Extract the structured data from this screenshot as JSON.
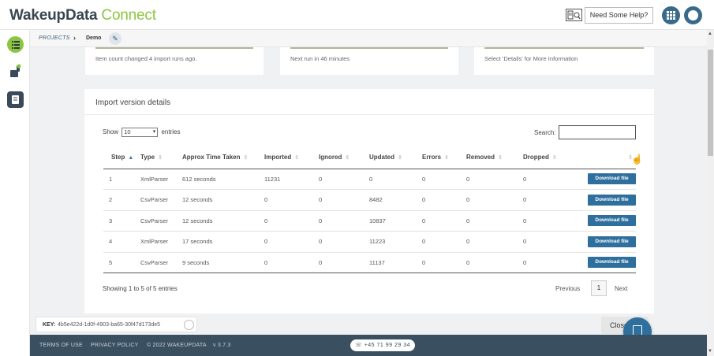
{
  "header": {
    "logo_primary": "WakeupData",
    "logo_secondary": "Connect",
    "help_label": "Need Some Help?"
  },
  "breadcrumb": {
    "projects": "PROJECTS",
    "separator": "›",
    "current": "Demo"
  },
  "summary_cards": [
    {
      "text": "Item count changed 4 import runs ago."
    },
    {
      "text": "Next run in 46 minutes"
    },
    {
      "text": "Select 'Details' for More Information"
    }
  ],
  "panel": {
    "title": "Import version details",
    "show_label": "Show",
    "page_size": "10",
    "entries_label": "entries",
    "search_label": "Search:",
    "search_value": "",
    "columns": [
      "Step",
      "Type",
      "Approx Time Taken",
      "Imported",
      "Ignored",
      "Updated",
      "Errors",
      "Removed",
      "Dropped",
      ""
    ],
    "rows": [
      {
        "step": "1",
        "type": "XmlParser",
        "time": "612 seconds",
        "imported": "11231",
        "ignored": "0",
        "updated": "0",
        "errors": "0",
        "removed": "0",
        "dropped": "0",
        "action": "Download file"
      },
      {
        "step": "2",
        "type": "CsvParser",
        "time": "12 seconds",
        "imported": "0",
        "ignored": "0",
        "updated": "8482",
        "errors": "0",
        "removed": "0",
        "dropped": "0",
        "action": "Download file"
      },
      {
        "step": "3",
        "type": "CsvParser",
        "time": "12 seconds",
        "imported": "0",
        "ignored": "0",
        "updated": "10837",
        "errors": "0",
        "removed": "0",
        "dropped": "0",
        "action": "Download file"
      },
      {
        "step": "4",
        "type": "XmlParser",
        "time": "17 seconds",
        "imported": "0",
        "ignored": "0",
        "updated": "11223",
        "errors": "0",
        "removed": "0",
        "dropped": "0",
        "action": "Download file"
      },
      {
        "step": "5",
        "type": "CsvParser",
        "time": "9 seconds",
        "imported": "0",
        "ignored": "0",
        "updated": "11137",
        "errors": "0",
        "removed": "0",
        "dropped": "0",
        "action": "Download file"
      }
    ],
    "showing_text": "Showing 1 to 5 of 5 entries",
    "prev_label": "Previous",
    "current_page": "1",
    "next_label": "Next"
  },
  "keybar": {
    "key_label": "KEY:",
    "key_value": "4b5e422d-1d0f-4903-ba65-30f47d173de5",
    "close_label": "Close"
  },
  "footer": {
    "terms": "TERMS OF USE",
    "privacy": "PRIVACY POLICY",
    "copyright": "© 2022 WAKEUPDATA",
    "version": "v 3.7.3",
    "phone": "+45 71 99 29 34"
  },
  "colors": {
    "brand_green": "#8cc63f",
    "brand_dark": "#3a4650",
    "button_blue": "#2e6f9e",
    "footer_bg": "#3a4f60"
  }
}
